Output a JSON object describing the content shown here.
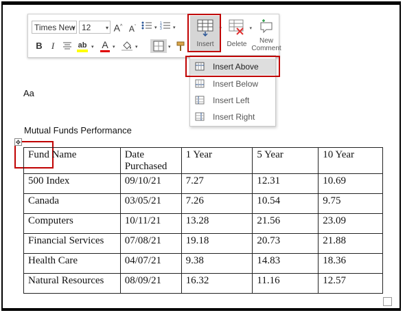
{
  "toolbar": {
    "font_name": "Times New",
    "font_size": "12",
    "insert_label": "Insert",
    "delete_label": "Delete",
    "new_comment_label": "New Comment",
    "grow_font": "A",
    "shrink_font": "A",
    "bold": "B",
    "italic": "I",
    "font_color": "A",
    "highlight": "ab"
  },
  "insert_menu": {
    "items": [
      {
        "label": "Insert Above",
        "highlighted": true
      },
      {
        "label": "Insert Below",
        "highlighted": false
      },
      {
        "label": "Insert Left",
        "highlighted": false
      },
      {
        "label": "Insert Right",
        "highlighted": false
      }
    ]
  },
  "document": {
    "aa_text": "Aa",
    "table_title": "Mutual Funds Performance",
    "table": {
      "headers": [
        "Fund Name",
        "Date Purchased",
        "1 Year",
        "5 Year",
        "10 Year"
      ],
      "rows": [
        [
          "500 Index",
          "09/10/21",
          "7.27",
          "12.31",
          "10.69"
        ],
        [
          "Canada",
          "03/05/21",
          "7.26",
          "10.54",
          "9.75"
        ],
        [
          "Computers",
          "10/11/21",
          "13.28",
          "21.56",
          "23.09"
        ],
        [
          "Financial Services",
          "07/08/21",
          "19.18",
          "20.73",
          "21.88"
        ],
        [
          "Health Care",
          "04/07/21",
          "9.38",
          "14.83",
          "18.36"
        ],
        [
          "Natural Resources",
          "08/09/21",
          "16.32",
          "11.16",
          "12.57"
        ]
      ]
    }
  },
  "colors": {
    "callout_red": "#c00000",
    "font_color_underline": "#e00000",
    "highlight_yellow": "#ffff00",
    "delete_red": "#e03030"
  }
}
